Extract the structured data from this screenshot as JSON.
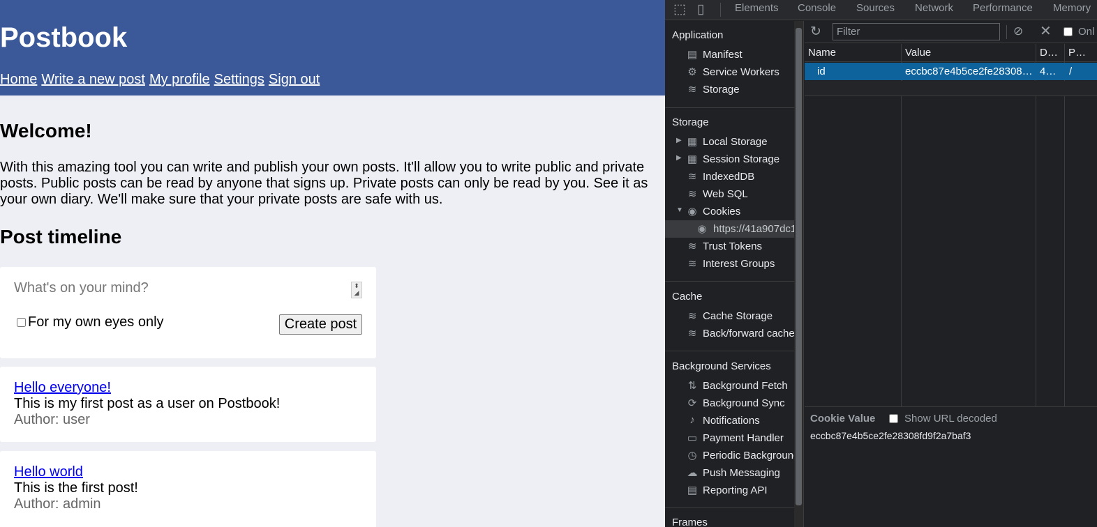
{
  "site": {
    "title": "Postbook",
    "nav": [
      "Home",
      "Write a new post",
      "My profile",
      "Settings",
      "Sign out"
    ],
    "welcome_heading": "Welcome!",
    "intro": "With this amazing tool you can write and publish your own posts. It'll allow you to write public and private posts. Public posts can be read by anyone that signs up. Private posts can only be read by you. See it as your own diary. We'll make sure that your private posts are safe with us.",
    "timeline_heading": "Post timeline",
    "composer": {
      "placeholder": "What's on your mind?",
      "private_label": "For my own eyes only",
      "private_checked": false,
      "submit_label": "Create post"
    },
    "posts": [
      {
        "title": "Hello everyone!",
        "body": "This is my first post as a user on Postbook!",
        "author": "Author: user"
      },
      {
        "title": "Hello world",
        "body": "This is the first post!",
        "author": "Author: admin"
      }
    ],
    "colors": {
      "header": "#3b5998",
      "background": "#edeff4",
      "link": "#0000ee"
    }
  },
  "devtools": {
    "tabs": [
      "Elements",
      "Console",
      "Sources",
      "Network",
      "Performance",
      "Memory"
    ],
    "toolbar_icons": [
      "inspect-icon",
      "device-toolbar-icon"
    ],
    "sidebar": {
      "application": {
        "heading": "Application",
        "items": [
          {
            "label": "Manifest",
            "icon": "file-icon"
          },
          {
            "label": "Service Workers",
            "icon": "gear-icon"
          },
          {
            "label": "Storage",
            "icon": "database-icon"
          }
        ]
      },
      "storage": {
        "heading": "Storage",
        "items": [
          {
            "label": "Local Storage",
            "icon": "grid-icon",
            "expandable": true,
            "expanded": false
          },
          {
            "label": "Session Storage",
            "icon": "grid-icon",
            "expandable": true,
            "expanded": false
          },
          {
            "label": "IndexedDB",
            "icon": "database-icon"
          },
          {
            "label": "Web SQL",
            "icon": "database-icon"
          },
          {
            "label": "Cookies",
            "icon": "cookie-icon",
            "expandable": true,
            "expanded": true
          },
          {
            "label": "https://41a907dc1",
            "icon": "cookie-icon",
            "selected": true
          },
          {
            "label": "Trust Tokens",
            "icon": "database-icon"
          },
          {
            "label": "Interest Groups",
            "icon": "database-icon"
          }
        ]
      },
      "cache": {
        "heading": "Cache",
        "items": [
          {
            "label": "Cache Storage",
            "icon": "database-icon"
          },
          {
            "label": "Back/forward cache",
            "icon": "database-icon"
          }
        ]
      },
      "background_services": {
        "heading": "Background Services",
        "items": [
          {
            "label": "Background Fetch",
            "icon": "up-down-arrows-icon"
          },
          {
            "label": "Background Sync",
            "icon": "sync-icon"
          },
          {
            "label": "Notifications",
            "icon": "bell-icon"
          },
          {
            "label": "Payment Handler",
            "icon": "credit-card-icon"
          },
          {
            "label": "Periodic Background",
            "icon": "clock-icon"
          },
          {
            "label": "Push Messaging",
            "icon": "cloud-icon"
          },
          {
            "label": "Reporting API",
            "icon": "file-icon"
          }
        ]
      },
      "frames": {
        "heading": "Frames"
      }
    },
    "cookies": {
      "filter_placeholder": "Filter",
      "only_label": "Onl",
      "columns": [
        "Name",
        "Value",
        "D…",
        "P…"
      ],
      "rows": [
        {
          "name": "id",
          "value": "eccbc87e4b5ce2fe28308…",
          "domain": "4…",
          "path": "/"
        }
      ],
      "selected_row": 0,
      "detail": {
        "title": "Cookie Value",
        "decode_label": "Show URL decoded",
        "value": "eccbc87e4b5ce2fe28308fd9f2a7baf3"
      }
    },
    "colors": {
      "panel": "#202124",
      "selection": "#0e639c",
      "text": "#e8eaed",
      "muted": "#9aa0a6"
    }
  }
}
